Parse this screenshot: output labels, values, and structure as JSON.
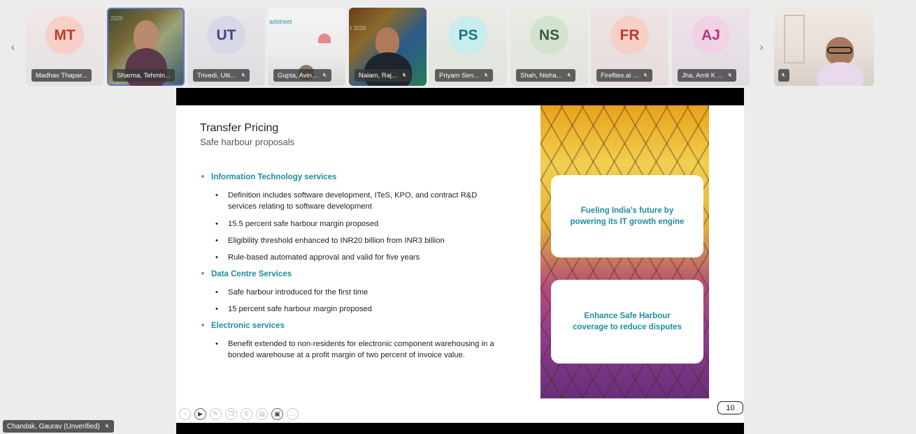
{
  "participants": [
    {
      "initials": "MT",
      "name": "Madhav Thapar...",
      "color": "#c0392b",
      "avatar_bg": "#f6d0c6"
    },
    {
      "initials": "",
      "name": "Sharma, Tehmin...",
      "watermark": "2026",
      "active": true
    },
    {
      "initials": "UT",
      "name": "Trivedi, Utk...",
      "color": "#3d4a7a",
      "avatar_bg": "#d6d8e8"
    },
    {
      "initials": "",
      "name": "Gupta, Avin...",
      "watermark": "adstreet"
    },
    {
      "initials": "",
      "name": "Nalam, Raj...",
      "watermark": "t 2026"
    },
    {
      "initials": "PS",
      "name": "Priyam Sen...",
      "color": "#1a7a7a",
      "avatar_bg": "#c9ecee"
    },
    {
      "initials": "NS",
      "name": "Shah, Nisha...",
      "color": "#3d5a3d",
      "avatar_bg": "#d3e3d0"
    },
    {
      "initials": "FR",
      "name": "Fireflies.ai ...",
      "color": "#c0392b",
      "avatar_bg": "#f6d0c6"
    },
    {
      "initials": "AJ",
      "name": "Jha, Amit K ...",
      "color": "#b03a7a",
      "avatar_bg": "#f1d1e6"
    }
  ],
  "nav": {
    "prev": "‹",
    "next": "›"
  },
  "slide": {
    "title": "Transfer Pricing",
    "subtitle": "Safe harbour proposals",
    "sections": [
      {
        "heading": "Information Technology services",
        "items": [
          "Definition includes software development, ITeS, KPO, and contract R&D services relating to software development",
          "15.5 percent safe harbour margin proposed",
          "Eligibility threshold enhanced to INR20 billion from INR3 billion",
          "Rule-based automated approval and valid for five years"
        ]
      },
      {
        "heading": "Data Centre Services",
        "items": [
          "Safe harbour introduced for the first time",
          "15 percent safe harbour margin proposed"
        ]
      },
      {
        "heading": "Electronic services",
        "items": [
          "Benefit extended to non-residents for electronic component warehousing in a bonded warehouse at a profit margin of two percent of invoice value."
        ]
      }
    ],
    "cards": [
      "Fueling India’s future by powering its IT growth engine",
      "Enhance Safe Harbour coverage to reduce disputes"
    ],
    "page_number": "10",
    "bullet": "•"
  },
  "toolbar_icons": [
    "back-icon",
    "pointer-icon",
    "pen-icon",
    "copy-icon",
    "zoom-icon",
    "subtitles-icon",
    "video-icon",
    "more-icon"
  ],
  "self_view": {
    "name": "Chandak, Gaurav (Unverified)"
  },
  "colors": {
    "accent": "#1e8da0",
    "active_outline": "#6b72d6"
  }
}
